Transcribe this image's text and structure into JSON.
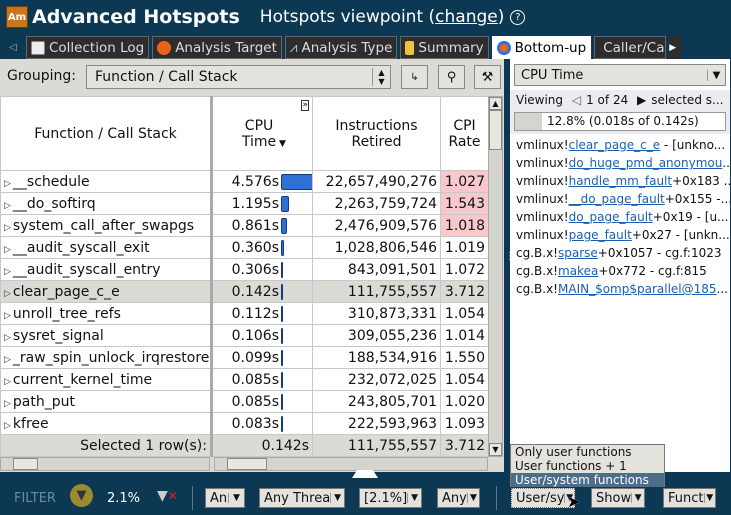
{
  "header": {
    "logo": "Am",
    "title": "Advanced Hotspots",
    "viewpoint_prefix": "Hotspots viewpoint (",
    "viewpoint_link": "change",
    "viewpoint_suffix": ")",
    "help": "?"
  },
  "tabs": [
    {
      "label": "Collection Log",
      "icon": "collection-log-icon"
    },
    {
      "label": "Analysis Target",
      "icon": "target-icon"
    },
    {
      "label": "Analysis Type",
      "icon": "compass-icon"
    },
    {
      "label": "Summary",
      "icon": "summary-icon"
    },
    {
      "label": "Bottom-up",
      "icon": "bottom-up-icon",
      "active": true
    },
    {
      "label": "Caller/Ca",
      "icon": "caller-callee-icon"
    }
  ],
  "grouping": {
    "label": "Grouping:",
    "value": "Function / Call Stack"
  },
  "table": {
    "columns": [
      "Function / Call Stack",
      "CPU Time",
      "Instructions Retired",
      "CPI Rate"
    ],
    "rows": [
      {
        "name": "__schedule",
        "cpu": "4.576s",
        "cpu_value": 4.576,
        "instr": "22,657,490,276",
        "cpi": "1.027",
        "hot": true
      },
      {
        "name": "__do_softirq",
        "cpu": "1.195s",
        "cpu_value": 1.195,
        "instr": "2,263,759,724",
        "cpi": "1.543",
        "hot": true
      },
      {
        "name": "system_call_after_swapgs",
        "cpu": "0.861s",
        "cpu_value": 0.861,
        "instr": "2,476,909,576",
        "cpi": "1.018",
        "hot": true
      },
      {
        "name": "__audit_syscall_exit",
        "cpu": "0.360s",
        "cpu_value": 0.36,
        "instr": "1,028,806,546",
        "cpi": "1.019"
      },
      {
        "name": "__audit_syscall_entry",
        "cpu": "0.306s",
        "cpu_value": 0.306,
        "instr": "843,091,501",
        "cpi": "1.072"
      },
      {
        "name": "clear_page_c_e",
        "cpu": "0.142s",
        "cpu_value": 0.142,
        "instr": "111,755,557",
        "cpi": "3.712",
        "selected": true
      },
      {
        "name": "unroll_tree_refs",
        "cpu": "0.112s",
        "cpu_value": 0.112,
        "instr": "310,873,331",
        "cpi": "1.054"
      },
      {
        "name": "sysret_signal",
        "cpu": "0.106s",
        "cpu_value": 0.106,
        "instr": "309,055,236",
        "cpi": "1.014"
      },
      {
        "name": "_raw_spin_unlock_irqrestore",
        "cpu": "0.099s",
        "cpu_value": 0.099,
        "instr": "188,534,916",
        "cpi": "1.550"
      },
      {
        "name": "current_kernel_time",
        "cpu": "0.085s",
        "cpu_value": 0.085,
        "instr": "232,072,025",
        "cpi": "1.054"
      },
      {
        "name": "path_put",
        "cpu": "0.085s",
        "cpu_value": 0.085,
        "instr": "243,805,701",
        "cpi": "1.020"
      },
      {
        "name": "kfree",
        "cpu": "0.083s",
        "cpu_value": 0.083,
        "instr": "222,593,963",
        "cpi": "1.093"
      }
    ],
    "summary": {
      "label": "Selected 1 row(s):",
      "cpu": "0.142s",
      "instr": "111,755,557",
      "cpi": "3.712"
    }
  },
  "side": {
    "metric": "CPU Time",
    "viewing": "Viewing",
    "page": "1 of 24",
    "selected": "selected s...",
    "progress_text": "12.8% (0.018s of 0.142s)",
    "progress": 12.8,
    "stack": [
      {
        "pre": "vmlinux!",
        "link": "clear_page_c_e",
        "post": " - [unkno..."
      },
      {
        "pre": "vmlinux!",
        "link": "do_huge_pmd_anonymou",
        "post": "..."
      },
      {
        "pre": "vmlinux!",
        "link": "handle_mm_fault",
        "post": "+0x183 ..."
      },
      {
        "pre": "vmlinux!",
        "link": "__do_page_fault",
        "post": "+0x155 -..."
      },
      {
        "pre": "vmlinux!",
        "link": "do_page_fault",
        "post": "+0x19 - [u..."
      },
      {
        "pre": "vmlinux!",
        "link": "page_fault",
        "post": "+0x27 - [unkn..."
      },
      {
        "pre": "cg.B.x!",
        "link": "sparse",
        "post": "+0x1057 - cg.f:1023"
      },
      {
        "pre": "cg.B.x!",
        "link": "makea",
        "post": "+0x772 - cg.f:815"
      },
      {
        "pre": "cg.B.x!",
        "link": "MAIN_$omp$parallel@185",
        "post": "..."
      }
    ]
  },
  "filter": {
    "label": "FILTER",
    "percent": "2.1%",
    "buttons": [
      "An",
      "Any Threa",
      "[2.1%]",
      "Any",
      "User/sy",
      "Show",
      "Funct"
    ],
    "popup": [
      "Only user functions",
      "User functions + 1",
      "User/system functions"
    ],
    "popup_selected": 2
  }
}
